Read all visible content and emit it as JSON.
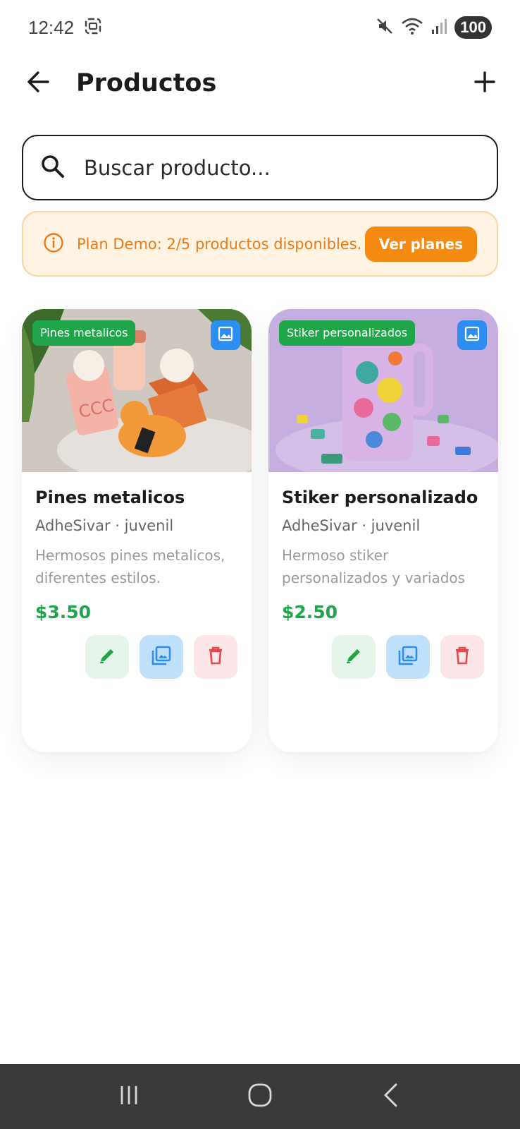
{
  "status_bar": {
    "time": "12:42",
    "battery": "100",
    "icons": [
      "screenshot-icon",
      "mute-icon",
      "wifi-icon",
      "signal-icon"
    ]
  },
  "header": {
    "title": "Productos",
    "back_icon": "arrow-left-icon",
    "add_icon": "plus-icon"
  },
  "search": {
    "placeholder": "Buscar producto...",
    "value": ""
  },
  "plan_banner": {
    "text": "Plan Demo: 2/5 productos disponibles.",
    "button_label": "Ver planes",
    "colors": {
      "bg": "#fff3e3",
      "text": "#ea7a1a",
      "button": "#f58a10"
    }
  },
  "products": [
    {
      "tag": "Pines metalicos",
      "title": "Pines metalicos",
      "meta": "AdheSivar · juvenil",
      "description": "Hermosos pines metalicos, diferentes estilos.",
      "price": "$3.50"
    },
    {
      "tag": "Stiker personalizados",
      "title": "Stiker personalizado",
      "meta": "AdheSivar · juvenil",
      "description": "Hermoso stiker personalizados y variados",
      "price": "$2.50"
    }
  ],
  "colors": {
    "accent_green": "#1fa54a",
    "accent_blue": "#2b8ef0",
    "delete_red": "#e5484d"
  }
}
